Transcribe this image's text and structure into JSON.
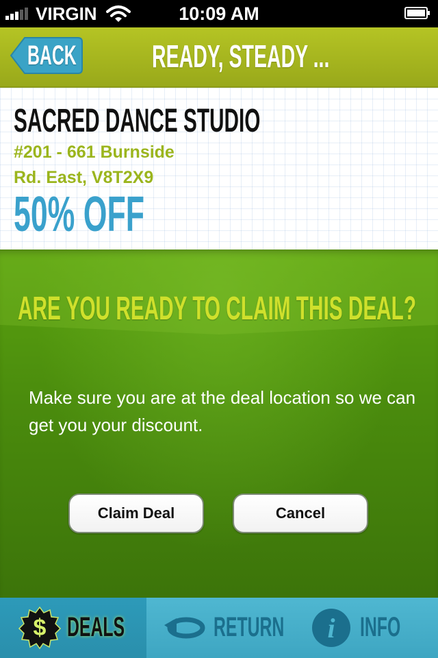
{
  "status_bar": {
    "carrier": "VIRGIN",
    "time": "10:09 AM",
    "icons": [
      "signal-icon",
      "wifi-icon",
      "battery-icon"
    ]
  },
  "header": {
    "back_label": "BACK",
    "title": "READY, STEADY ..."
  },
  "deal": {
    "business_name": "SACRED DANCE STUDIO",
    "address_line1": "#201 - 661 Burnside",
    "address_line2": "Rd. East, V8T2X9",
    "discount": "50% OFF"
  },
  "claim": {
    "question": "ARE YOU READY TO CLAIM THIS DEAL?",
    "message": "Make sure you are at the deal location so we can get you your discount.",
    "claim_button": "Claim Deal",
    "cancel_button": "Cancel"
  },
  "tabs": [
    {
      "label": "DEALS",
      "icon": "dollar-badge-icon",
      "selected": true
    },
    {
      "label": "RETURN",
      "icon": "return-arrow-icon",
      "selected": false
    },
    {
      "label": "INFO",
      "icon": "info-icon",
      "selected": false
    }
  ],
  "colors": {
    "header_green": "#a8b820",
    "claim_green": "#4a8b0d",
    "accent_blue": "#3aa1cc",
    "address_green": "#9bb51d",
    "question_yellow": "#cfe02c",
    "tab_blue": "#4fb7d1"
  }
}
